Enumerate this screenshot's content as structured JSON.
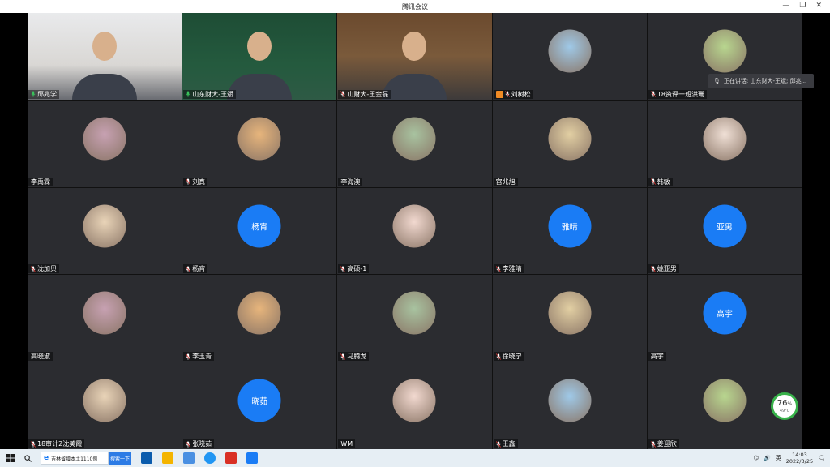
{
  "window": {
    "title": "腾讯会议"
  },
  "participants": [
    {
      "name": "邱兆学",
      "type": "video",
      "mic": "on"
    },
    {
      "name": "山东财大-王斌",
      "type": "video",
      "mic": "on",
      "active": true
    },
    {
      "name": "山财大-王金磊",
      "type": "video",
      "mic": "muted"
    },
    {
      "name": "刘树松",
      "type": "photo",
      "mic": "muted",
      "host_badge": true
    },
    {
      "name": "18资评一班洪珊",
      "type": "photo",
      "mic": "muted"
    },
    {
      "name": "李禹霖",
      "type": "photo",
      "mic": "none"
    },
    {
      "name": "刘真",
      "type": "photo",
      "mic": "muted"
    },
    {
      "name": "李海澳",
      "type": "photo",
      "mic": "none"
    },
    {
      "name": "宫兆旭",
      "type": "photo",
      "mic": "none"
    },
    {
      "name": "韩敏",
      "type": "photo",
      "mic": "muted"
    },
    {
      "name": "沈加贝",
      "type": "photo",
      "mic": "muted"
    },
    {
      "name": "杨宵",
      "type": "initials",
      "initials": "杨宵",
      "mic": "muted"
    },
    {
      "name": "高硕-1",
      "type": "photo",
      "mic": "muted"
    },
    {
      "name": "李雅晴",
      "type": "initials",
      "initials": "雅晴",
      "mic": "muted"
    },
    {
      "name": "姚亚男",
      "type": "initials",
      "initials": "亚男",
      "mic": "muted"
    },
    {
      "name": "高晓淑",
      "type": "photo",
      "mic": "none"
    },
    {
      "name": "李玉青",
      "type": "photo",
      "mic": "muted"
    },
    {
      "name": "马腾龙",
      "type": "photo",
      "mic": "muted"
    },
    {
      "name": "徐晓宁",
      "type": "photo",
      "mic": "muted"
    },
    {
      "name": "高宇",
      "type": "initials",
      "initials": "高宇",
      "mic": "none"
    },
    {
      "name": "18审计2沈美霞",
      "type": "photo",
      "mic": "muted"
    },
    {
      "name": "张晓茹",
      "type": "initials",
      "initials": "晓茹",
      "mic": "muted"
    },
    {
      "name": "WM",
      "type": "photo",
      "mic": "none"
    },
    {
      "name": "王鑫",
      "type": "photo",
      "mic": "muted"
    },
    {
      "name": "姜迎欣",
      "type": "photo",
      "mic": "muted"
    }
  ],
  "speaking": {
    "label": "正在讲话: 山东财大-王斌; 邱兆..."
  },
  "network": {
    "percent": "76",
    "unit": "%",
    "temp": "49°C"
  },
  "taskbar": {
    "search_text": "吉林省增本土1110例",
    "search_button": "搜索一下",
    "time": "14:03",
    "date": "2022/3/25"
  },
  "colors": {
    "accent_blue": "#1a7cf5",
    "active_border": "#f0b400",
    "tile_bg": "#2b2c30"
  }
}
